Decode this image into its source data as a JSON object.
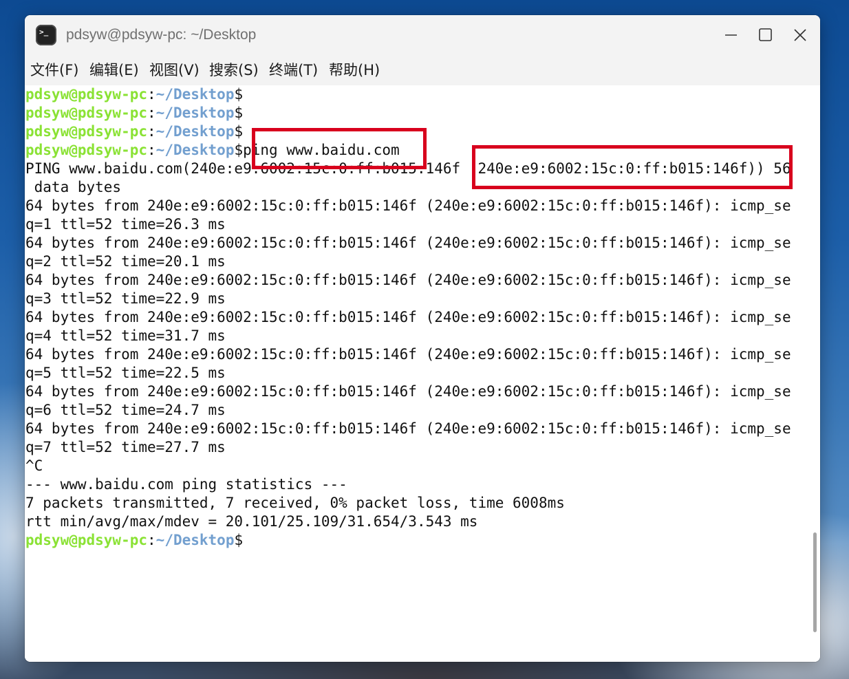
{
  "window": {
    "title": "pdsyw@pdsyw-pc: ~/Desktop",
    "icon_name": "terminal-icon",
    "icon_glyph": ">_",
    "controls": [
      "minimize-icon",
      "maximize-icon",
      "close-icon"
    ]
  },
  "menu": {
    "items": [
      "文件(F)",
      "编辑(E)",
      "视图(V)",
      "搜索(S)",
      "终端(T)",
      "帮助(H)"
    ]
  },
  "colors": {
    "prompt_user": "#8ae234",
    "prompt_path": "#729fcf",
    "highlight_box": "#d8001d",
    "text": "#111111"
  },
  "prompt": {
    "user": "pdsyw@pdsyw-pc",
    "colon": ":",
    "path": "~/Desktop",
    "dollar": "$"
  },
  "terminal": {
    "command": "ping www.baidu.com",
    "ping_header": "PING www.baidu.com(240e:e9:6002:15c:0:ff:b015:146f (240e:e9:6002:15c:0:ff:b015:146f)) 56",
    "ping_header_wrap": " data bytes",
    "replies": [
      {
        "line1": "64 bytes from 240e:e9:6002:15c:0:ff:b015:146f (240e:e9:6002:15c:0:ff:b015:146f): icmp_se",
        "line2": "q=1 ttl=52 time=26.3 ms"
      },
      {
        "line1": "64 bytes from 240e:e9:6002:15c:0:ff:b015:146f (240e:e9:6002:15c:0:ff:b015:146f): icmp_se",
        "line2": "q=2 ttl=52 time=20.1 ms"
      },
      {
        "line1": "64 bytes from 240e:e9:6002:15c:0:ff:b015:146f (240e:e9:6002:15c:0:ff:b015:146f): icmp_se",
        "line2": "q=3 ttl=52 time=22.9 ms"
      },
      {
        "line1": "64 bytes from 240e:e9:6002:15c:0:ff:b015:146f (240e:e9:6002:15c:0:ff:b015:146f): icmp_se",
        "line2": "q=4 ttl=52 time=31.7 ms"
      },
      {
        "line1": "64 bytes from 240e:e9:6002:15c:0:ff:b015:146f (240e:e9:6002:15c:0:ff:b015:146f): icmp_se",
        "line2": "q=5 ttl=52 time=22.5 ms"
      },
      {
        "line1": "64 bytes from 240e:e9:6002:15c:0:ff:b015:146f (240e:e9:6002:15c:0:ff:b015:146f): icmp_se",
        "line2": "q=6 ttl=52 time=24.7 ms"
      },
      {
        "line1": "64 bytes from 240e:e9:6002:15c:0:ff:b015:146f (240e:e9:6002:15c:0:ff:b015:146f): icmp_se",
        "line2": "q=7 ttl=52 time=27.7 ms"
      }
    ],
    "interrupt": "^C",
    "stats_header": "--- www.baidu.com ping statistics ---",
    "stats_packets": "7 packets transmitted, 7 received, 0% packet loss, time 6008ms",
    "stats_rtt": "rtt min/avg/max/mdev = 20.101/25.109/31.654/3.543 ms"
  }
}
